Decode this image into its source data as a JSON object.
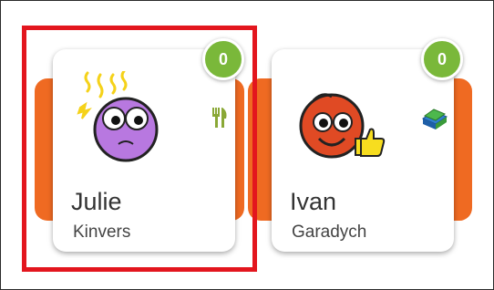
{
  "students": [
    {
      "first_name": "Julie",
      "last_name": "Kinvers",
      "points": "0",
      "avatar": "purple-stressed-monster-icon",
      "skill_icon": "fork-knife-icon"
    },
    {
      "first_name": "Ivan",
      "last_name": "Garadych",
      "points": "0",
      "avatar": "orange-thumbs-up-monster-icon",
      "skill_icon": "books-icon"
    }
  ],
  "colors": {
    "accent_band": "#ef6a22",
    "badge": "#7ab83a",
    "selection": "#e3161e"
  }
}
